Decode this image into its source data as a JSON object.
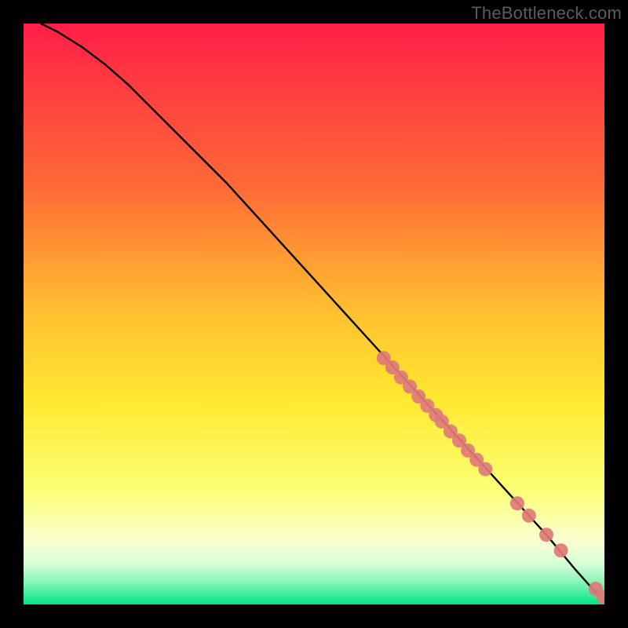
{
  "watermark": "TheBottleneck.com",
  "colors": {
    "gradient_top": "#ff1f47",
    "gradient_mid_upper": "#ff8a2f",
    "gradient_mid": "#ffe931",
    "gradient_lower": "#fbff8c",
    "gradient_pale": "#f7ffe0",
    "gradient_bottom": "#00e582",
    "curve": "#000000",
    "markers": "#e07a78"
  },
  "chart_data": {
    "type": "scatter",
    "title": "",
    "xlabel": "",
    "ylabel": "",
    "xlim": [
      0,
      100
    ],
    "ylim": [
      0,
      100
    ],
    "grid": false,
    "legend": false,
    "series": [
      {
        "name": "curve",
        "kind": "line",
        "x": [
          3,
          6,
          10,
          14,
          18,
          22,
          26,
          30,
          35,
          40,
          45,
          50,
          55,
          60,
          65,
          70,
          75,
          80,
          85,
          90,
          95,
          99
        ],
        "y": [
          100,
          98.5,
          96,
          93,
          89.5,
          85.5,
          81.5,
          77.5,
          72.5,
          67,
          61.5,
          56,
          50.5,
          45,
          39.5,
          34,
          28.5,
          23,
          17.5,
          12,
          6,
          1.5
        ]
      },
      {
        "name": "markers-main",
        "kind": "scatter",
        "x": [
          62,
          63.5,
          65,
          66.5,
          68,
          69.5,
          71,
          72,
          73.5,
          75,
          76.5,
          78,
          79.5
        ],
        "y": [
          42.4,
          40.8,
          39.1,
          37.5,
          35.8,
          34.2,
          32.6,
          31.5,
          29.8,
          28.2,
          26.5,
          24.9,
          23.3
        ]
      },
      {
        "name": "markers-lower",
        "kind": "scatter",
        "x": [
          85,
          87,
          90,
          92.5,
          98.5,
          99.8
        ],
        "y": [
          17.4,
          15.3,
          12.0,
          9.3,
          2.7,
          1.3
        ]
      },
      {
        "name": "markers-bottom-pair",
        "kind": "scatter",
        "x": [
          100.5,
          101
        ],
        "y": [
          0.4,
          0.2
        ]
      }
    ]
  }
}
